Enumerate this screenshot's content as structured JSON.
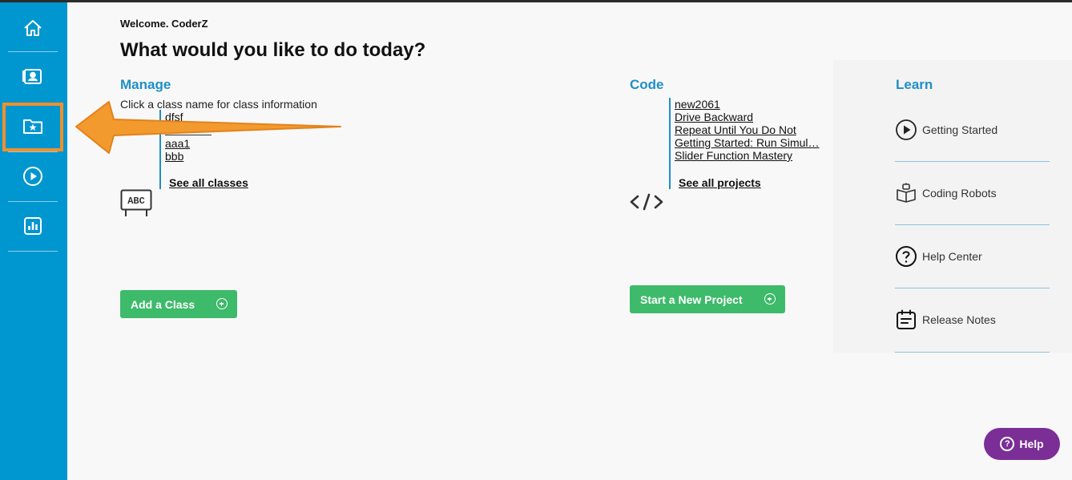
{
  "header": {
    "welcome": "Welcome. CoderZ",
    "title": "What would you like to do today?"
  },
  "manage": {
    "title": "Manage",
    "hint": "Click a class name for class information",
    "classes": [
      "dfsf",
      "aaa1",
      "bbb"
    ],
    "see_all": "See all classes",
    "add_button": "Add a Class",
    "icon_text": "ABC"
  },
  "code": {
    "title": "Code",
    "projects": [
      "new2061",
      "Drive Backward",
      "Repeat Until You Do Not",
      "Getting Started: Run Simul…",
      "Slider Function Mastery"
    ],
    "see_all": "See all projects",
    "new_button": "Start a New Project"
  },
  "learn": {
    "title": "Learn",
    "items": [
      {
        "label": "Getting Started",
        "icon": "play-circle-icon"
      },
      {
        "label": "Coding Robots",
        "icon": "robot-book-icon"
      },
      {
        "label": "Help Center",
        "icon": "question-circle-icon"
      },
      {
        "label": "Release Notes",
        "icon": "notes-icon"
      }
    ]
  },
  "sidebar": {
    "items": [
      {
        "icon": "home-icon"
      },
      {
        "icon": "classes-icon"
      },
      {
        "icon": "favorites-folder-icon",
        "highlighted": true
      },
      {
        "icon": "play-icon"
      },
      {
        "icon": "reports-chart-icon"
      }
    ]
  },
  "help_button": {
    "label": "Help"
  },
  "colors": {
    "sidebar": "#0096cf",
    "accent": "#1f8fc6",
    "green": "#3dba6a",
    "help": "#7b2f96",
    "annotation": "#f0902b"
  }
}
